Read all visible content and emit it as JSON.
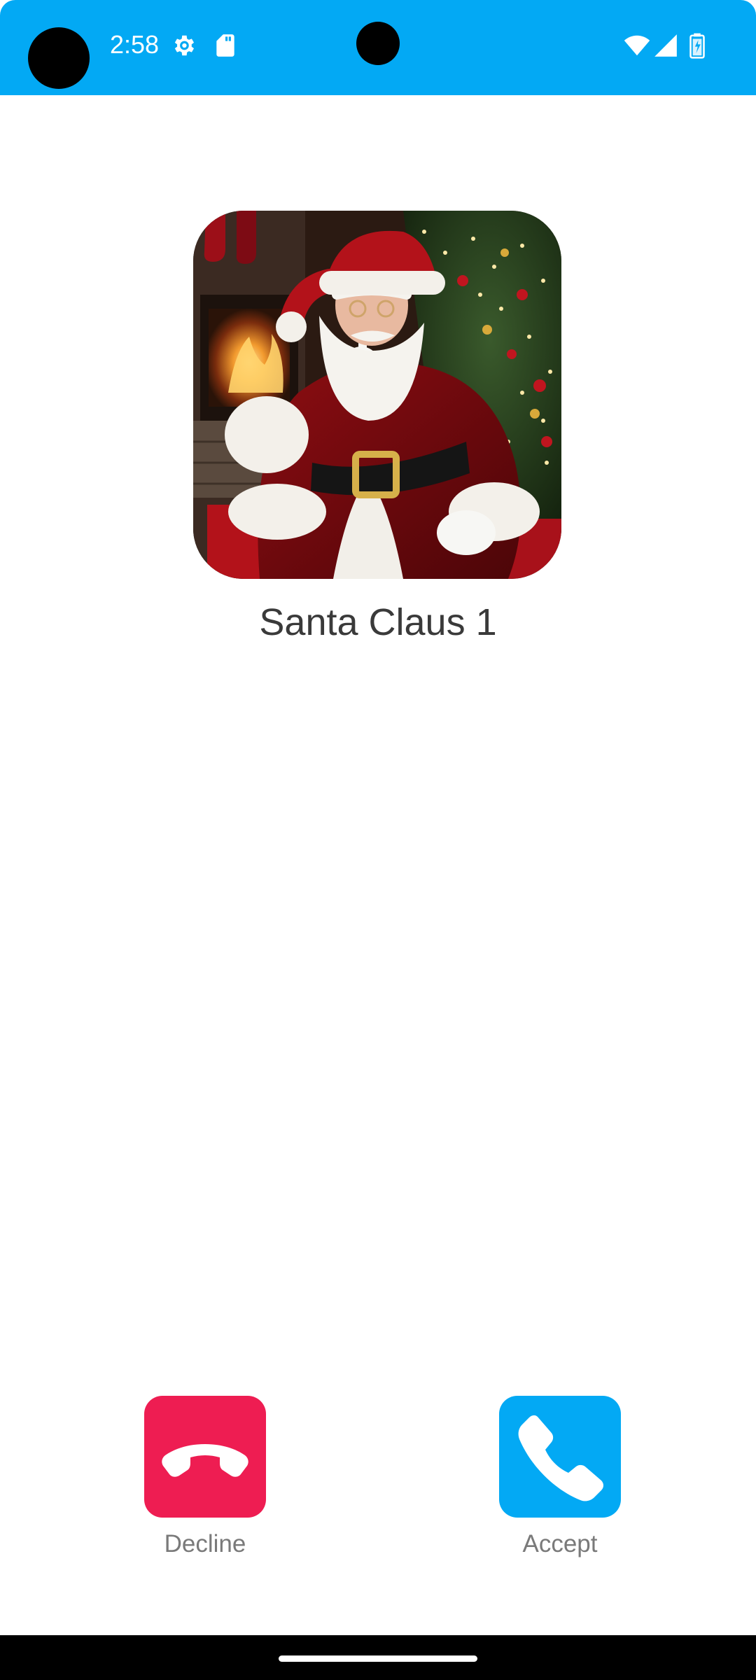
{
  "status_bar": {
    "time": "2:58",
    "background": "#03A9F4",
    "icons": [
      "settings-gear-icon",
      "sd-card-icon",
      "wifi-icon",
      "cell-signal-icon",
      "battery-icon"
    ]
  },
  "caller": {
    "name": "Santa Claus 1",
    "avatar": "santa-claus-photo"
  },
  "actions": {
    "decline": {
      "label": "Decline",
      "color": "#EE1D52",
      "icon": "phone-hangup-icon"
    },
    "accept": {
      "label": "Accept",
      "color": "#03A9F4",
      "icon": "phone-icon"
    }
  }
}
